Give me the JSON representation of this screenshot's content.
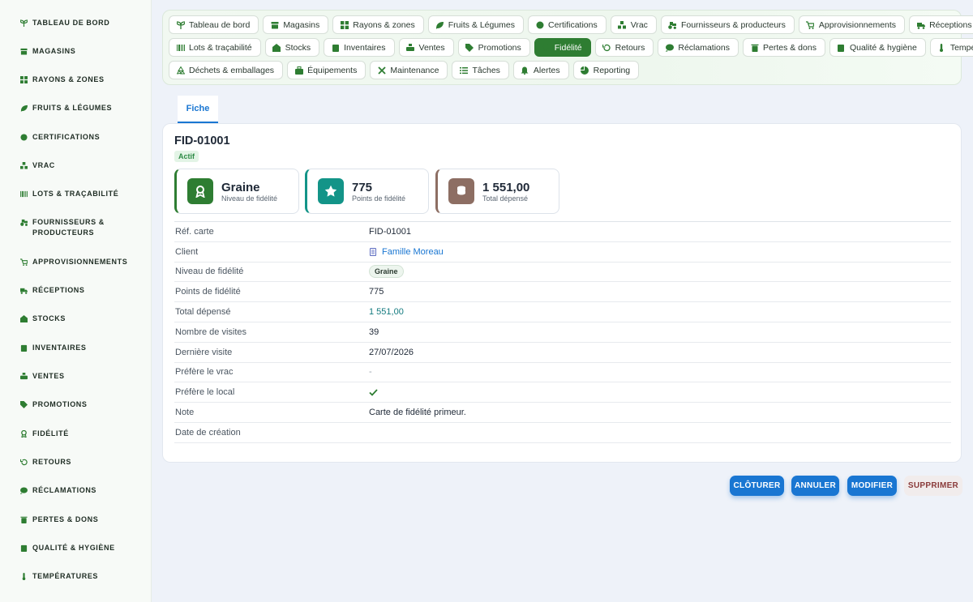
{
  "sidebar": {
    "items": [
      {
        "label": "Tableau de bord",
        "icon": "sprout-icon"
      },
      {
        "label": "Magasins",
        "icon": "store-icon"
      },
      {
        "label": "Rayons & zones",
        "icon": "grid-icon"
      },
      {
        "label": "Fruits & Légumes",
        "icon": "leaf-icon"
      },
      {
        "label": "Certifications",
        "icon": "badge-icon"
      },
      {
        "label": "Vrac",
        "icon": "boxes-icon"
      },
      {
        "label": "Lots & traçabilité",
        "icon": "barcode-icon"
      },
      {
        "label": "Fournisseurs & producteurs",
        "icon": "tractor-icon"
      },
      {
        "label": "Approvisionnements",
        "icon": "cart-icon"
      },
      {
        "label": "Réceptions",
        "icon": "truck-icon"
      },
      {
        "label": "Stocks",
        "icon": "warehouse-icon"
      },
      {
        "label": "Inventaires",
        "icon": "clipboard-icon"
      },
      {
        "label": "Ventes",
        "icon": "basket-icon"
      },
      {
        "label": "Promotions",
        "icon": "tag-icon"
      },
      {
        "label": "Fidélité",
        "icon": "award-icon"
      },
      {
        "label": "Retours",
        "icon": "undo-icon"
      },
      {
        "label": "Réclamations",
        "icon": "chat-icon"
      },
      {
        "label": "Pertes & dons",
        "icon": "trash-icon"
      },
      {
        "label": "Qualité & hygiène",
        "icon": "clipboard-check-icon"
      },
      {
        "label": "Températures",
        "icon": "thermometer-icon"
      }
    ]
  },
  "nav": {
    "rows": [
      [
        {
          "label": "Tableau de bord",
          "icon": "sprout-icon"
        },
        {
          "label": "Magasins",
          "icon": "store-icon"
        },
        {
          "label": "Rayons & zones",
          "icon": "grid-icon"
        },
        {
          "label": "Fruits & Légumes",
          "icon": "leaf-icon"
        },
        {
          "label": "Certifications",
          "icon": "badge-icon"
        },
        {
          "label": "Vrac",
          "icon": "boxes-icon"
        },
        {
          "label": "Fournisseurs & producteurs",
          "icon": "tractor-icon"
        },
        {
          "label": "Approvisionnements",
          "icon": "cart-icon"
        },
        {
          "label": "Réceptions",
          "icon": "truck-icon"
        }
      ],
      [
        {
          "label": "Lots & traçabilité",
          "icon": "barcode-icon"
        },
        {
          "label": "Stocks",
          "icon": "warehouse-icon"
        },
        {
          "label": "Inventaires",
          "icon": "clipboard-icon"
        },
        {
          "label": "Ventes",
          "icon": "basket-icon"
        },
        {
          "label": "Promotions",
          "icon": "tag-icon"
        },
        {
          "label": "Fidélité",
          "icon": "award-icon",
          "active": true
        },
        {
          "label": "Retours",
          "icon": "undo-icon"
        },
        {
          "label": "Réclamations",
          "icon": "chat-icon"
        },
        {
          "label": "Pertes & dons",
          "icon": "trash-icon"
        },
        {
          "label": "Qualité & hygiène",
          "icon": "clipboard-check-icon"
        },
        {
          "label": "Températures",
          "icon": "thermometer-icon"
        }
      ],
      [
        {
          "label": "Déchets & emballages",
          "icon": "recycle-icon"
        },
        {
          "label": "Équipements",
          "icon": "toolbox-icon"
        },
        {
          "label": "Maintenance",
          "icon": "tools-icon"
        },
        {
          "label": "Tâches",
          "icon": "list-icon"
        },
        {
          "label": "Alertes",
          "icon": "bell-icon"
        },
        {
          "label": "Reporting",
          "icon": "pie-icon"
        }
      ]
    ]
  },
  "tabs": {
    "fiche": "Fiche"
  },
  "record": {
    "title": "FID-01001",
    "status": "Actif",
    "stats": [
      {
        "value": "Graine",
        "label": "Niveau de fidélité",
        "color": "#2e7d32",
        "icon": "award-icon"
      },
      {
        "value": "775",
        "label": "Points de fidélité",
        "color": "#139488",
        "icon": "star-icon"
      },
      {
        "value": "1 551,00",
        "label": "Total dépensé",
        "color": "#8d6e63",
        "icon": "coins-icon"
      }
    ],
    "fields": [
      {
        "key": "Réf. carte",
        "value": "FID-01001",
        "kind": "text"
      },
      {
        "key": "Client",
        "value": "Famille Moreau",
        "kind": "link"
      },
      {
        "key": "Niveau de fidélité",
        "value": "Graine",
        "kind": "chip"
      },
      {
        "key": "Points de fidélité",
        "value": "775",
        "kind": "text"
      },
      {
        "key": "Total dépensé",
        "value": "1 551,00",
        "kind": "teal"
      },
      {
        "key": "Nombre de visites",
        "value": "39",
        "kind": "text"
      },
      {
        "key": "Dernière visite",
        "value": "27/07/2026",
        "kind": "text"
      },
      {
        "key": "Préfère le vrac",
        "value": "-",
        "kind": "muted"
      },
      {
        "key": "Préfère le local",
        "value": "",
        "kind": "check"
      },
      {
        "key": "Note",
        "value": "Carte de fidélité primeur.",
        "kind": "text"
      },
      {
        "key": "Date de création",
        "value": "",
        "kind": "text"
      }
    ]
  },
  "actions": {
    "close": "CLÔTURER",
    "cancel": "ANNULER",
    "edit": "MODIFIER",
    "delete": "SUPPRIMER"
  },
  "colors": {
    "brand_green": "#2e7d32",
    "accent_blue": "#1976d2"
  }
}
